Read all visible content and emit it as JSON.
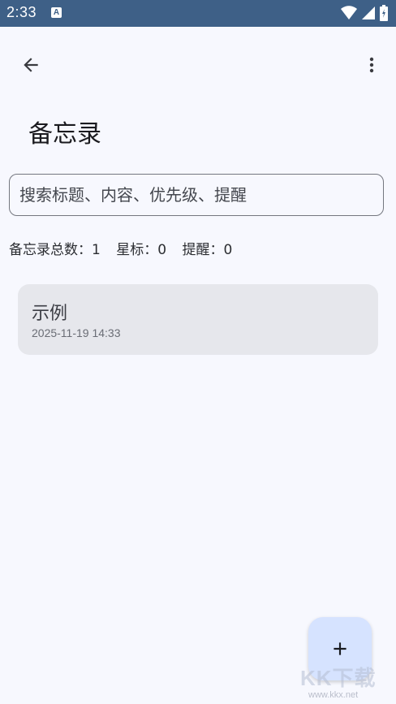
{
  "status_bar": {
    "time": "2:33",
    "app_icon_glyph": "A"
  },
  "app_bar": {
    "back_icon": "arrow-back-icon",
    "menu_icon": "more-vert-icon"
  },
  "page": {
    "title": "备忘录"
  },
  "search": {
    "placeholder": "搜索标题、内容、优先级、提醒",
    "value": ""
  },
  "stats": {
    "total_label": "备忘录总数：",
    "total_value": "1",
    "starred_label": "星标：",
    "starred_value": "0",
    "reminder_label": "提醒：",
    "reminder_value": "0"
  },
  "memos": [
    {
      "title": "示例",
      "timestamp": "2025-11-19 14:33"
    }
  ],
  "fab": {
    "icon": "add-icon"
  },
  "watermark": {
    "logo_text": "KK下载",
    "url": "www.kkx.net"
  },
  "colors": {
    "status_bar": "#3e6087",
    "background": "#f7f8fe",
    "card": "#e6e7ec",
    "fab": "#d6e3ff"
  }
}
